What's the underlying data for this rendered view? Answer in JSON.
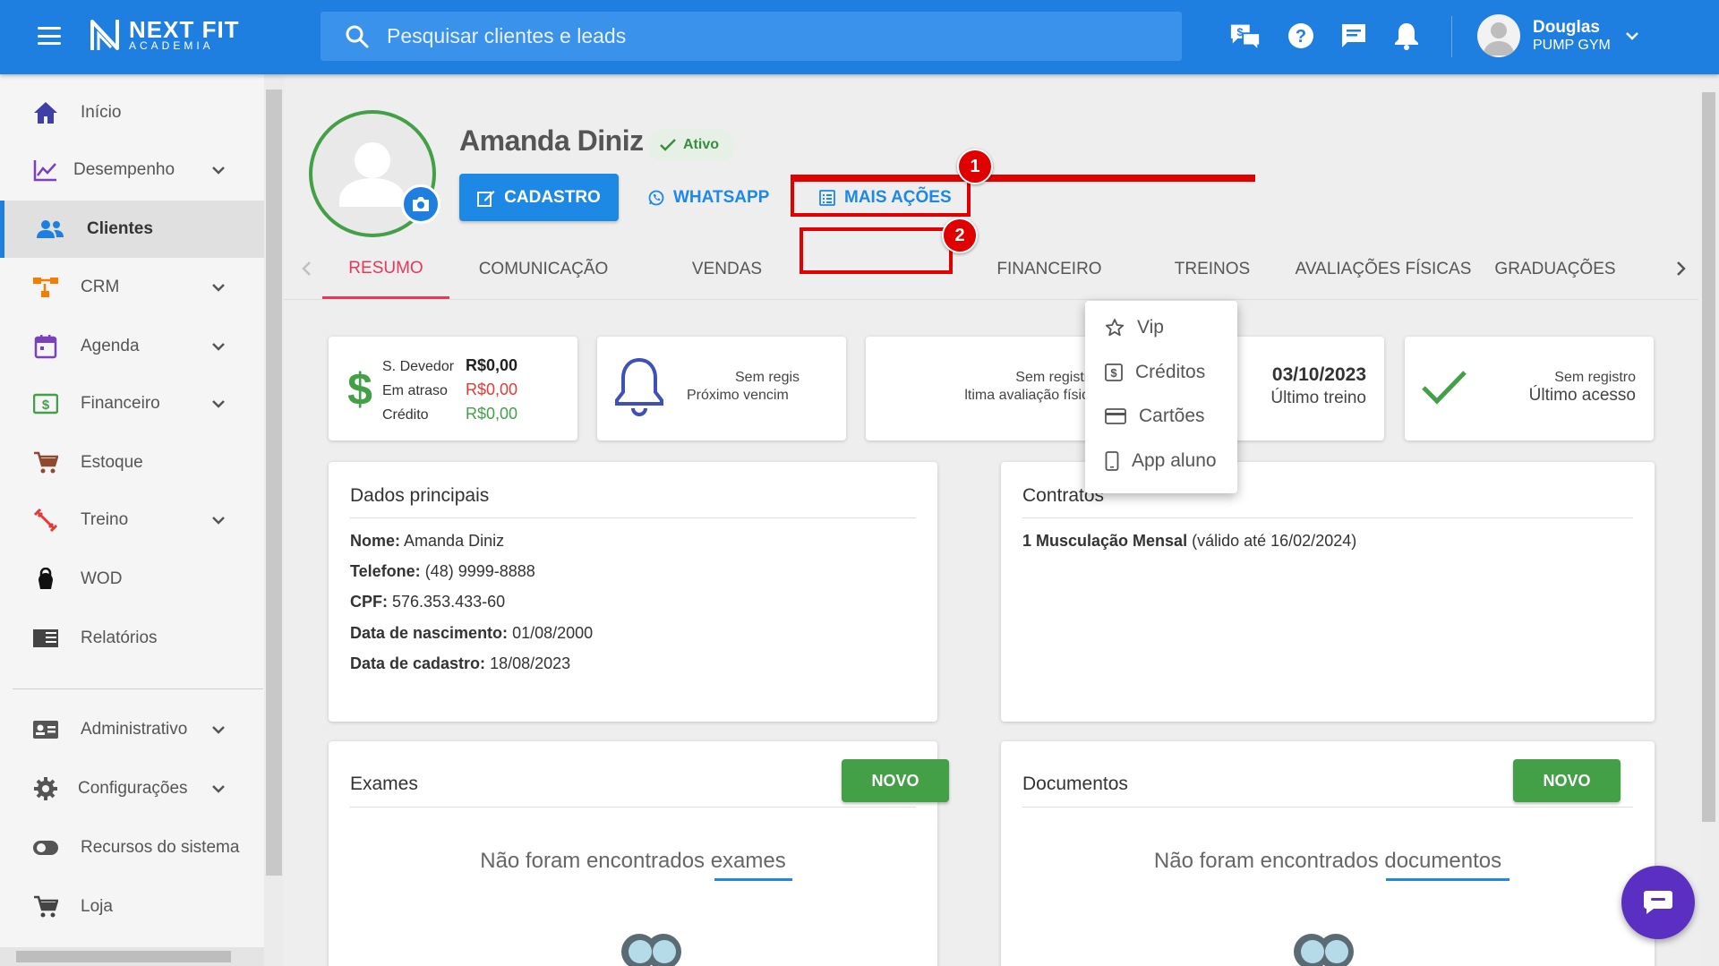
{
  "header": {
    "logo_line1": "NEXT FIT",
    "logo_line2": "ACADEMIA",
    "search_placeholder": "Pesquisar clientes e leads",
    "user_name": "Douglas",
    "user_gym": "PUMP GYM"
  },
  "sidebar": {
    "items": [
      {
        "label": "Início",
        "icon": "home-icon"
      },
      {
        "label": "Desempenho",
        "icon": "chart-line-icon"
      },
      {
        "label": "Clientes",
        "icon": "users-icon"
      },
      {
        "label": "CRM",
        "icon": "crm-icon"
      },
      {
        "label": "Agenda",
        "icon": "calendar-icon"
      },
      {
        "label": "Financeiro",
        "icon": "money-icon"
      },
      {
        "label": "Estoque",
        "icon": "cart-icon"
      },
      {
        "label": "Treino",
        "icon": "dumbbell-icon"
      },
      {
        "label": "WOD",
        "icon": "kettlebell-icon"
      },
      {
        "label": "Relatórios",
        "icon": "report-icon"
      },
      {
        "label": "Administrativo",
        "icon": "id-card-icon"
      },
      {
        "label": "Configurações",
        "icon": "gear-icon"
      },
      {
        "label": "Recursos do sistema",
        "icon": "toggle-icon"
      },
      {
        "label": "Loja",
        "icon": "cart-icon"
      }
    ]
  },
  "profile": {
    "name": "Amanda Diniz",
    "status": "Ativo",
    "btn_cadastro": "CADASTRO",
    "btn_whatsapp": "WHATSAPP",
    "btn_mais_acoes": "MAIS AÇÕES"
  },
  "tabs": [
    "RESUMO",
    "COMUNICAÇÃO",
    "VENDAS",
    "FINANCEIRO",
    "TREINOS",
    "AVALIAÇÕES FÍSICAS",
    "GRADUAÇÕES"
  ],
  "stats": {
    "debt_label": "S. Devedor",
    "debt_value": "R$0,00",
    "late_label": "Em atraso",
    "late_value": "R$0,00",
    "credit_label": "Crédito",
    "credit_value": "R$0,00",
    "card2_line1": "Sem regis",
    "card2_line2": "Próximo vencim",
    "card3_line1": "Sem registro",
    "card3_line2": "ltima avaliação física",
    "card4_line1": "03/10/2023",
    "card4_line2": "Último treino",
    "card5_line1": "Sem registro",
    "card5_line2": "Último acesso"
  },
  "dropdown": {
    "items": [
      "Vip",
      "Créditos",
      "Cartões",
      "App aluno"
    ]
  },
  "dados": {
    "title": "Dados principais",
    "nome_label": "Nome:",
    "nome": "Amanda Diniz",
    "telefone_label": "Telefone:",
    "telefone": "(48) 9999-8888",
    "cpf_label": "CPF:",
    "cpf": "576.353.433-60",
    "nasc_label": "Data de nascimento:",
    "nasc": "01/08/2000",
    "cad_label": "Data de cadastro:",
    "cad": "18/08/2023"
  },
  "contratos": {
    "title": "Contratos",
    "item_bold": "1 Musculação Mensal",
    "item_rest": "(válido até 16/02/2024)"
  },
  "exames": {
    "title": "Exames",
    "button": "NOVO",
    "empty": "Não foram encontrados exames"
  },
  "documentos": {
    "title": "Documentos",
    "button": "NOVO",
    "empty": "Não foram encontrados documentos"
  },
  "annotations": {
    "badge1": "1",
    "badge2": "2"
  },
  "colors": {
    "primary": "#1e7fe0",
    "accent_tab": "#e53959",
    "success": "#43a047",
    "danger": "#e53935",
    "highlight": "#e00000"
  }
}
